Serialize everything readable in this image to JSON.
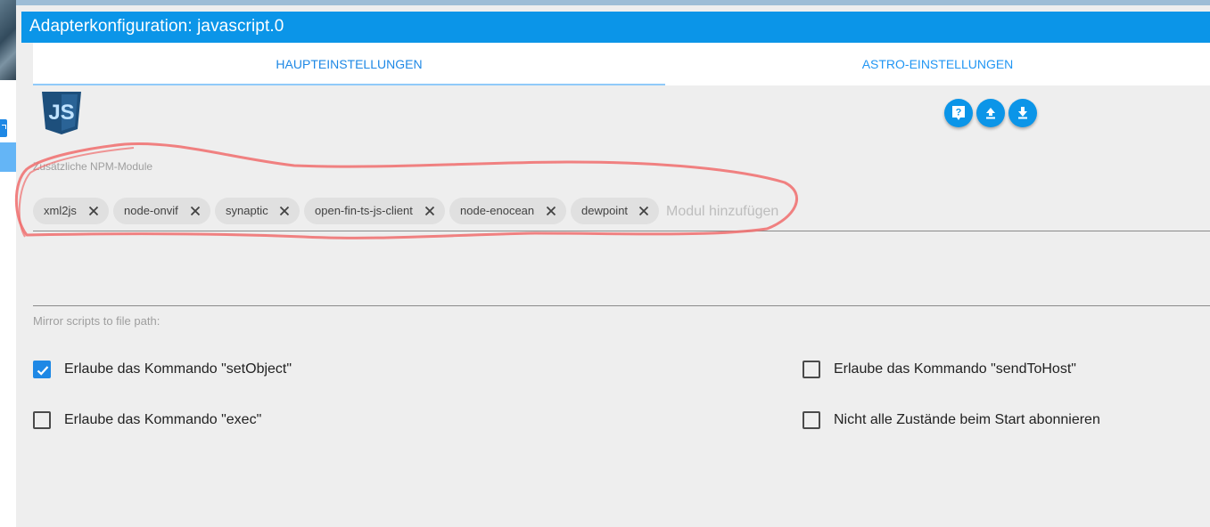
{
  "dialog": {
    "title": "Adapterkonfiguration: javascript.0"
  },
  "tabs": [
    {
      "label": "HAUPTEINSTELLUNGEN",
      "active": true
    },
    {
      "label": "ASTRO-EINSTELLUNGEN",
      "active": false
    }
  ],
  "logo": {
    "text": "JS",
    "color": "#1d4f7c"
  },
  "actions": {
    "help": "help-icon",
    "upload": "upload-icon",
    "download": "download-icon"
  },
  "npm_modules": {
    "label": "Zusätzliche NPM-Module",
    "chips": [
      "xml2js",
      "node-onvif",
      "synaptic",
      "open-fin-ts-js-client",
      "node-enocean",
      "dewpoint"
    ],
    "input_value": "Modul hinzufüge",
    "input_placeholder": "Modul hinzufügen"
  },
  "mirror": {
    "label": "Mirror scripts to file path:",
    "value": ""
  },
  "checkboxes": {
    "set_object": {
      "label": "Erlaube das Kommando \"setObject\"",
      "checked": true
    },
    "send_to_host": {
      "label": "Erlaube das Kommando \"sendToHost\"",
      "checked": false
    },
    "exec": {
      "label": "Erlaube das Kommando \"exec\"",
      "checked": false
    },
    "no_subscribe": {
      "label": "Nicht alle Zustände beim Start abonnieren",
      "checked": false
    }
  },
  "colors": {
    "accent": "#0b95e8",
    "checkbox": "#1e88e5",
    "annotation": "#f06c6c"
  }
}
